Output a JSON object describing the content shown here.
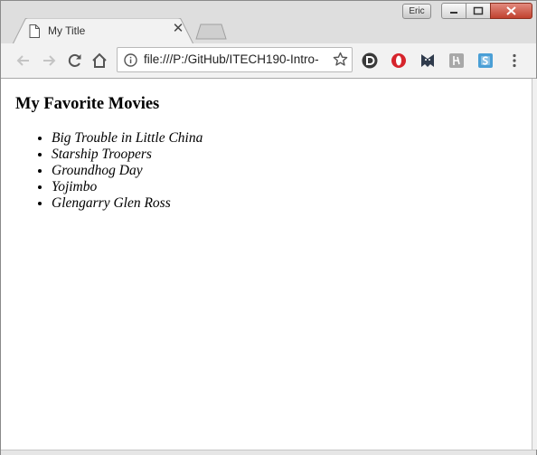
{
  "window": {
    "user_badge": "Eric",
    "tabs": [
      {
        "title": "My Title",
        "close_symbol": "✕",
        "icon": "document-icon"
      }
    ]
  },
  "toolbar": {
    "back_icon": "back-arrow-icon",
    "forward_icon": "forward-arrow-icon",
    "reload_icon": "reload-icon",
    "home_icon": "home-icon",
    "url": "file:///P:/GitHub/ITECH190-Intro-",
    "info_icon": "info-icon",
    "bookmark_icon": "star-icon",
    "extensions": [
      "disconnect-icon",
      "opera-icon",
      "ghostery-icon",
      "grammarly-icon",
      "skype-icon"
    ],
    "menu_icon": "kebab-menu-icon"
  },
  "page": {
    "heading": "My Favorite Movies",
    "movies": [
      "Big Trouble in Little China",
      "Starship Troopers",
      "Groundhog Day",
      "Yojimbo",
      "Glengarry Glen Ross"
    ]
  },
  "colors": {
    "tabstrip": "#dedede",
    "toolbar": "#f2f2f2",
    "close_button": "#c1422f",
    "opera_red": "#d6242c",
    "skype_blue": "#4a9fd6"
  }
}
